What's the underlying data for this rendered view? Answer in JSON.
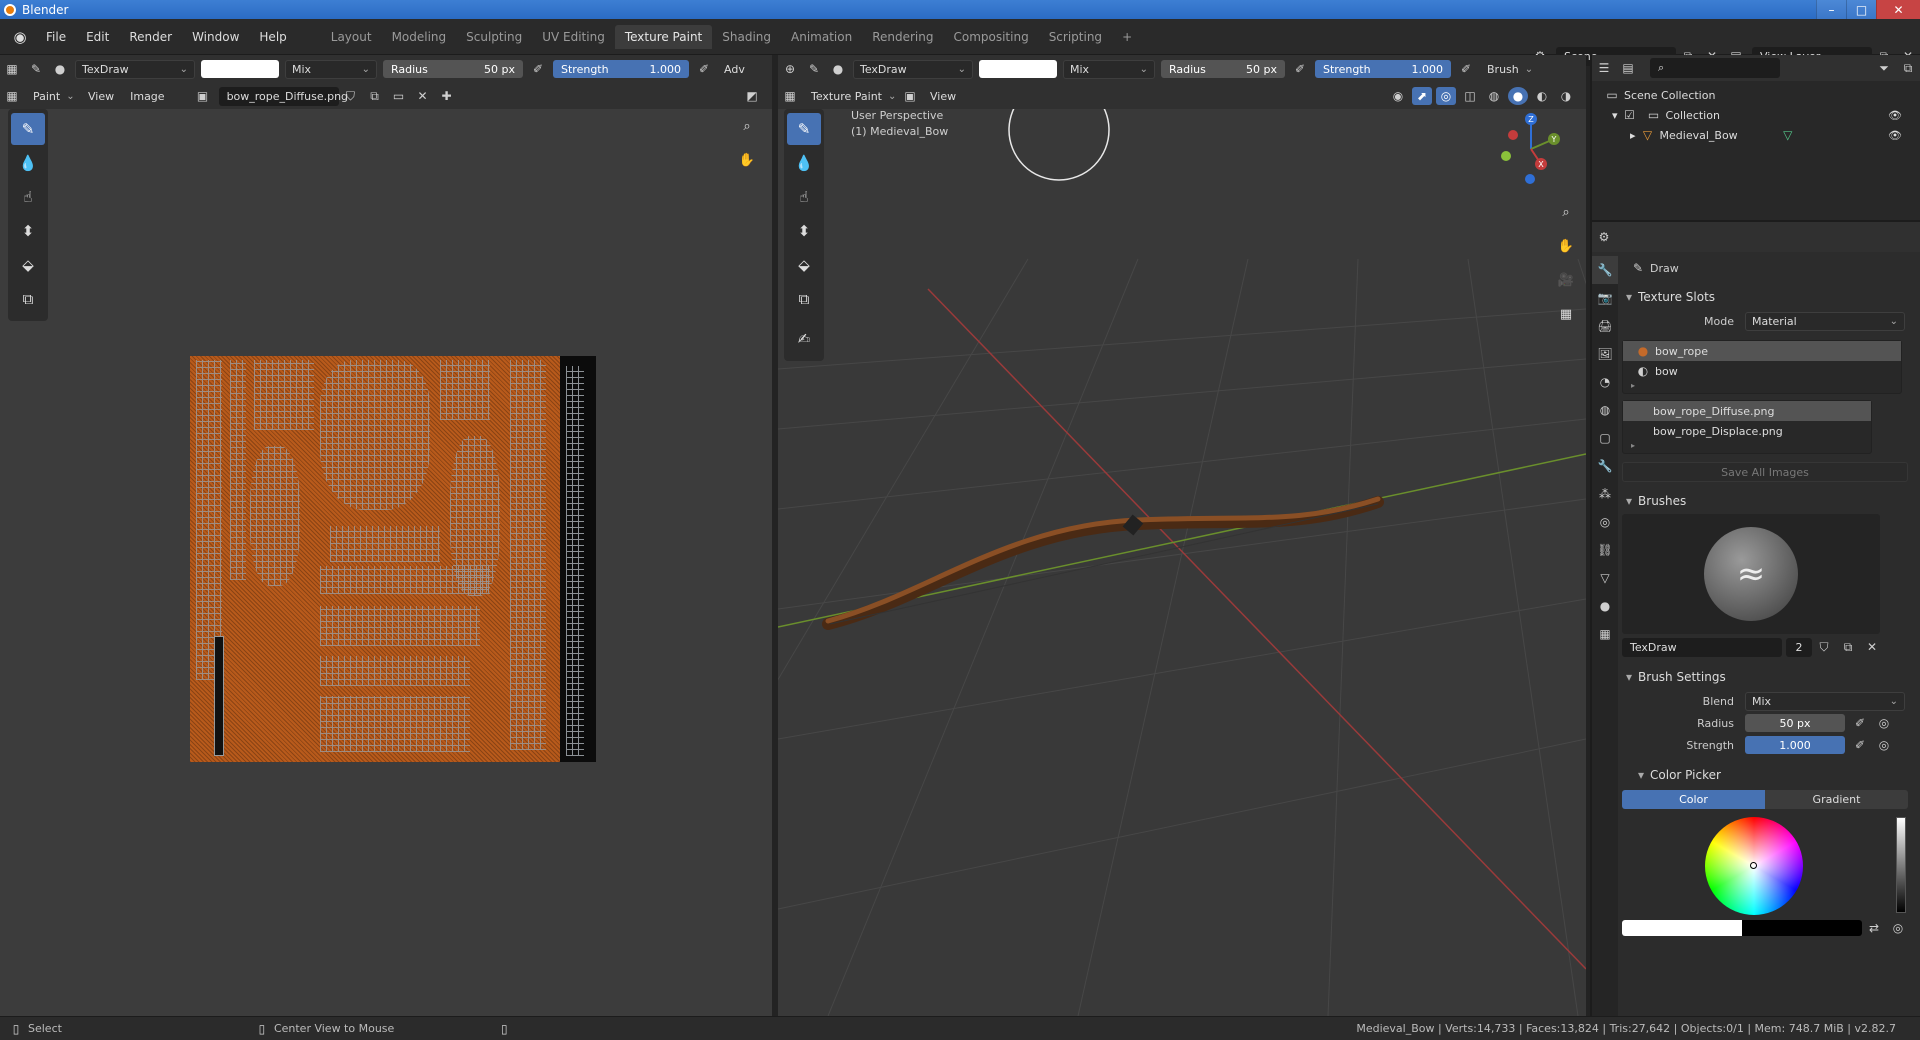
{
  "window": {
    "title": "Blender"
  },
  "menu": [
    "File",
    "Edit",
    "Render",
    "Window",
    "Help"
  ],
  "workspaces": [
    "Layout",
    "Modeling",
    "Sculpting",
    "UV Editing",
    "Texture Paint",
    "Shading",
    "Animation",
    "Rendering",
    "Compositing",
    "Scripting"
  ],
  "active_workspace": "Texture Paint",
  "scene": {
    "name": "Scene",
    "view_layer": "View Layer"
  },
  "image_editor": {
    "brush": "TexDraw",
    "blend": "Mix",
    "radius_label": "Radius",
    "radius": "50 px",
    "strength_label": "Strength",
    "strength": "1.000",
    "advanced": "Adv",
    "mode": "Paint",
    "view": "View",
    "image_menu": "Image",
    "image_name": "bow_rope_Diffuse.png"
  },
  "viewport": {
    "brush": "TexDraw",
    "blend": "Mix",
    "radius_label": "Radius",
    "radius": "50 px",
    "strength_label": "Strength",
    "strength": "1.000",
    "brush_menu": "Brush",
    "mode": "Texture Paint",
    "view": "View",
    "perspective": "User Perspective",
    "object_label": "(1) Medieval_Bow",
    "axes": {
      "x": "X",
      "y": "Y",
      "z": "Z"
    }
  },
  "outliner": {
    "scene_collection": "Scene Collection",
    "collection": "Collection",
    "object": "Medieval_Bow"
  },
  "properties": {
    "tool_name": "Draw",
    "texture_slots": {
      "title": "Texture Slots",
      "mode_label": "Mode",
      "mode": "Material",
      "materials": [
        "bow_rope",
        "bow"
      ],
      "images": [
        "bow_rope_Diffuse.png",
        "bow_rope_Displace.png"
      ],
      "save_all": "Save All Images"
    },
    "brushes": {
      "title": "Brushes",
      "brush_name": "TexDraw",
      "users": "2"
    },
    "brush_settings": {
      "title": "Brush Settings",
      "blend_label": "Blend",
      "blend": "Mix",
      "radius_label": "Radius",
      "radius": "50 px",
      "strength_label": "Strength",
      "strength": "1.000"
    },
    "color_picker": {
      "title": "Color Picker",
      "tab_color": "Color",
      "tab_gradient": "Gradient"
    }
  },
  "status": {
    "select": "Select",
    "center": "Center View to Mouse",
    "stats": "Medieval_Bow | Verts:14,733 | Faces:13,824 | Tris:27,642 | Objects:0/1 | Mem: 748.7 MiB | v2.82.7"
  },
  "colors": {
    "accent": "#4772b3",
    "texture": "#b85a1b"
  }
}
